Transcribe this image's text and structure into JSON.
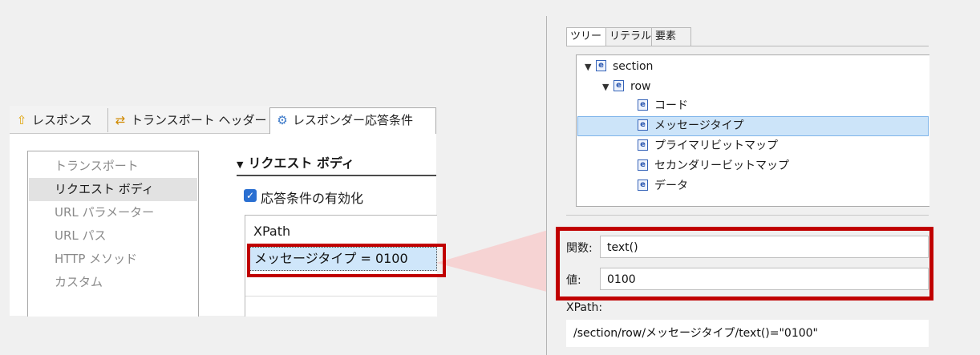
{
  "left": {
    "tabs": [
      {
        "icon": "response-arrow-icon",
        "label": "レスポンス"
      },
      {
        "icon": "transport-arrows-icon",
        "label": "トランスポート ヘッダー"
      },
      {
        "icon": "responder-gear-icon",
        "label": "レスポンダー応答条件"
      }
    ],
    "nav": [
      {
        "label": "トランスポート",
        "active": false
      },
      {
        "label": "リクエスト ボディ",
        "active": true
      },
      {
        "label": "URL パラメーター",
        "active": false
      },
      {
        "label": "URL パス",
        "active": false
      },
      {
        "label": "HTTP メソッド",
        "active": false
      },
      {
        "label": "カスタム",
        "active": false
      }
    ],
    "section_title": "リクエスト ボディ",
    "checkbox_label": "応答条件の有効化",
    "checkbox_checked": true,
    "xpath_header": "XPath",
    "xpath_row": "メッセージタイプ = 0100"
  },
  "right": {
    "tabs": [
      "ツリー",
      "リテラル",
      "要素"
    ],
    "tree": [
      {
        "label": "section",
        "expanded": true
      },
      {
        "label": "row",
        "expanded": true
      },
      {
        "label": "コード"
      },
      {
        "label": "メッセージタイプ",
        "selected": true
      },
      {
        "label": "プライマリビットマップ"
      },
      {
        "label": "セカンダリービットマップ"
      },
      {
        "label": "データ"
      }
    ],
    "element_icon_letter": "e",
    "function_label": "関数:",
    "function_value": "text()",
    "value_label": "値:",
    "value_value": "0100",
    "xpath_label": "XPath:",
    "xpath_value": "/section/row/メッセージタイプ/text()=\"0100\""
  },
  "colors": {
    "highlight_red": "#c00000",
    "selection_blue": "#cfe6fa",
    "connector_pink": "#f6cfcf",
    "checkbox_blue": "#2a6fd1"
  }
}
